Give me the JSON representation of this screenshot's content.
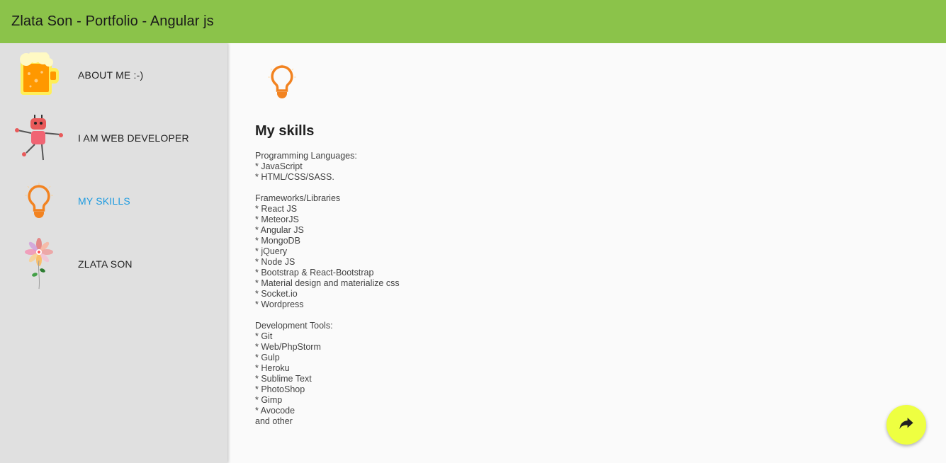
{
  "toolbar": {
    "title": "Zlata Son - Portfolio - Angular js"
  },
  "sidebar": {
    "items": [
      {
        "label": "ABOUT ME :-)",
        "icon": "beer-mug-icon"
      },
      {
        "label": "I AM WEB DEVELOPER",
        "icon": "robot-icon"
      },
      {
        "label": "MY SKILLS",
        "icon": "lightbulb-icon",
        "active": true
      },
      {
        "label": "ZLATA SON",
        "icon": "flower-icon"
      }
    ]
  },
  "main": {
    "title": "My skills",
    "groups": [
      {
        "heading": "Programming Languages:",
        "lines": [
          "* JavaScript",
          "* HTML/CSS/SASS."
        ]
      },
      {
        "heading": "Frameworks/Libraries",
        "lines": [
          "* React JS",
          "* MeteorJS",
          "* Angular JS",
          "* MongoDB",
          "* jQuery",
          "* Node JS",
          "* Bootstrap & React-Bootstrap",
          "* Material design and materialize css",
          "* Socket.io",
          "* Wordpress"
        ]
      },
      {
        "heading": "Development Tools:",
        "lines": [
          "* Git",
          "* Web/PhpStorm",
          "* Gulp",
          "* Heroku",
          "* Sublime Text",
          "* PhotoShop",
          "* Gimp",
          "* Avocode",
          "and other"
        ]
      }
    ]
  },
  "fab": {
    "icon": "share-arrow-icon"
  },
  "colors": {
    "toolbar": "#8bc34a",
    "sidebar": "#e0e0e0",
    "active": "#1e9be0",
    "fab": "#eeff41",
    "bulb": "#f28321"
  }
}
